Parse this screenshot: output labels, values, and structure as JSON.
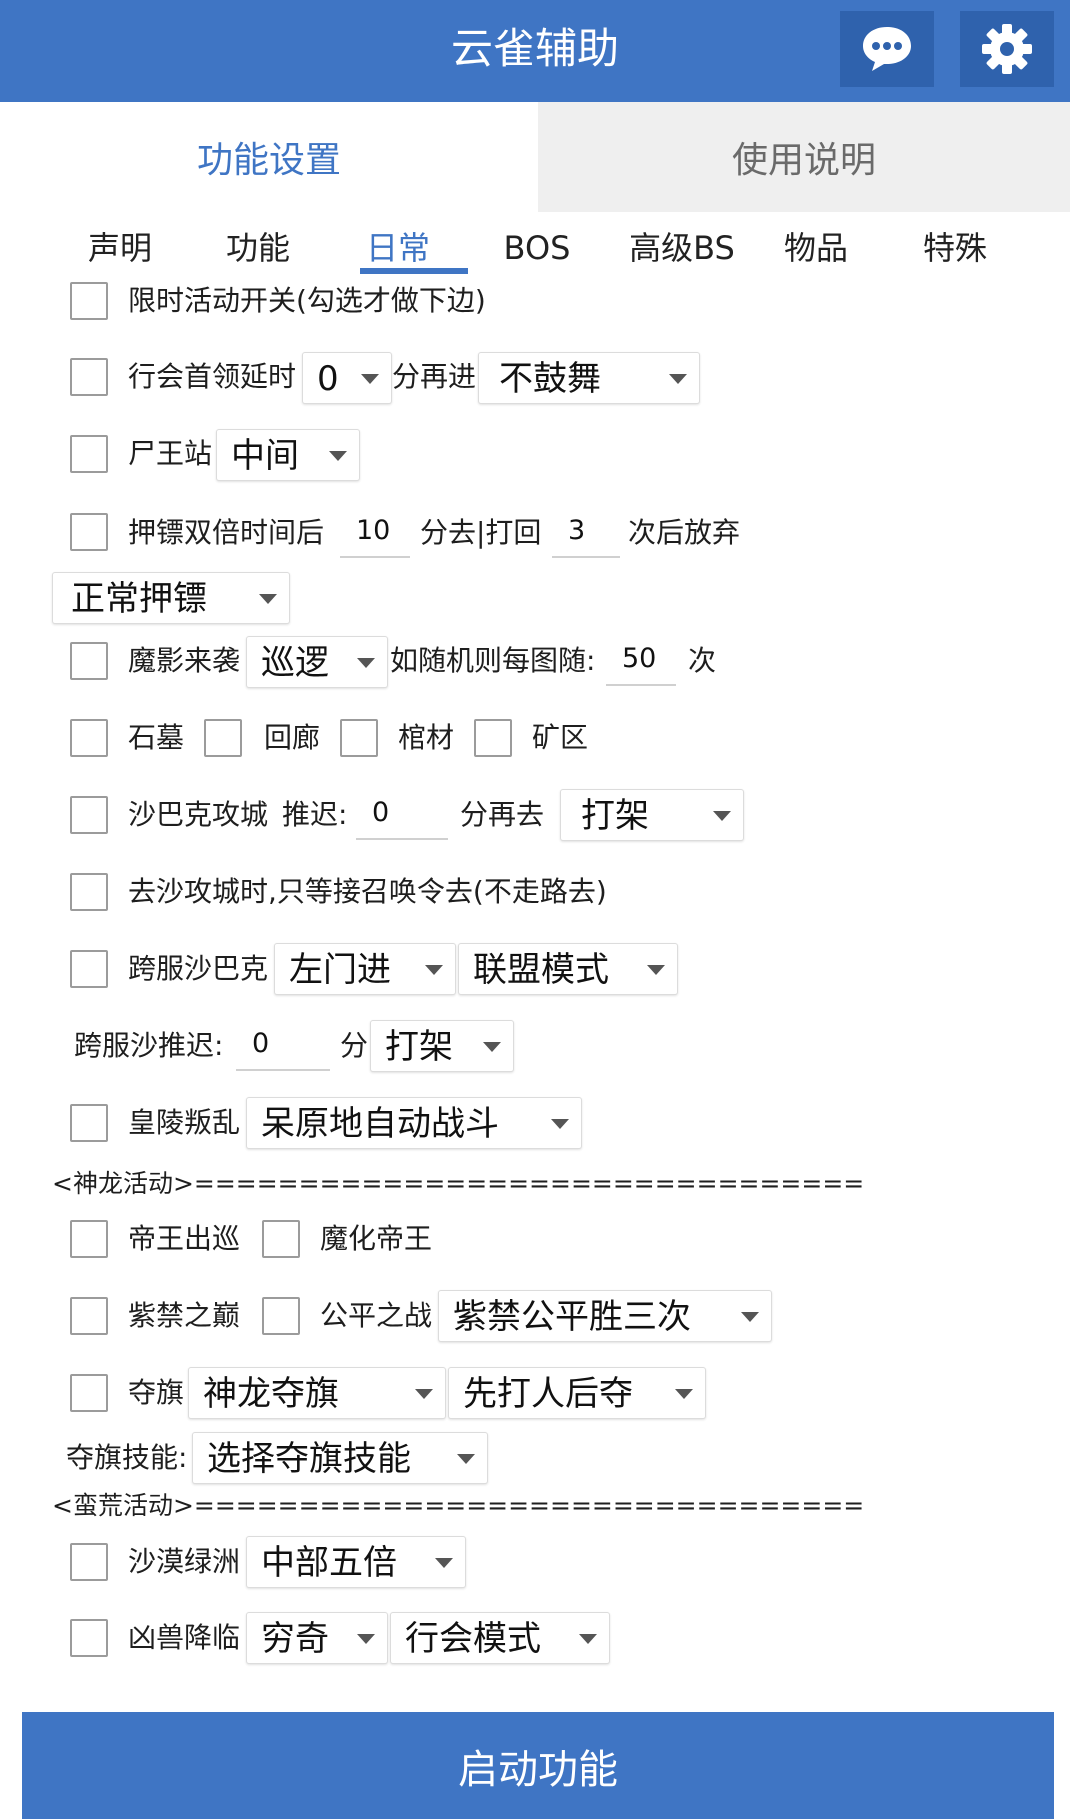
{
  "header": {
    "title": "云雀辅助",
    "chat_icon": "chat-bubble-icon",
    "settings_icon": "gear-icon",
    "color": "#3f75c4"
  },
  "main_tabs": [
    {
      "label": "功能设置",
      "active": true
    },
    {
      "label": "使用说明",
      "active": false
    }
  ],
  "sub_tabs": [
    {
      "label": "声明"
    },
    {
      "label": "功能"
    },
    {
      "label": "日常",
      "active": true
    },
    {
      "label": "BOS"
    },
    {
      "label": "高级BS"
    },
    {
      "label": "物品"
    },
    {
      "label": "特殊"
    }
  ],
  "rows": {
    "limited": {
      "label": "限时活动开关(勾选才做下边)"
    },
    "guild_leader": {
      "label": "行会首领延时",
      "delay": "0",
      "mid": "分再进",
      "mode": "不鼓舞"
    },
    "corpse_king": {
      "label": "尸王站",
      "pos": "中间"
    },
    "escort": {
      "label": "押镖双倍时间后",
      "minutes": "10",
      "mid": "分去|打回",
      "times": "3",
      "tail": "次后放弃",
      "mode": "正常押镖"
    },
    "shadow": {
      "label": "魔影来袭",
      "mode": "巡逻",
      "mid": "如随机则每图随:",
      "count": "50",
      "tail": "次"
    },
    "areas": {
      "items": [
        "石墓",
        "回廊",
        "棺材",
        "矿区"
      ]
    },
    "sabac": {
      "label": "沙巴克攻城",
      "delay_label": "推迟:",
      "delay": "0",
      "mid": "分再去",
      "mode": "打架"
    },
    "sabac_summon": {
      "label": "去沙攻城时,只等接召唤令去(不走路去)"
    },
    "cross_sabac": {
      "label": "跨服沙巴克",
      "gate": "左门进",
      "mode": "联盟模式"
    },
    "cross_delay": {
      "label": "跨服沙推迟:",
      "delay": "0",
      "unit": "分",
      "mode": "打架"
    },
    "tomb_revolt": {
      "label": "皇陵叛乱",
      "mode": "呆原地自动战斗"
    },
    "dragon_sep": "<神龙活动>================================",
    "emperor": {
      "label": "帝王出巡",
      "label2": "魔化帝王"
    },
    "forbidden": {
      "label": "紫禁之巅",
      "label2": "公平之战",
      "mode": "紫禁公平胜三次"
    },
    "flag": {
      "label": "夺旗",
      "mode": "神龙夺旗",
      "strategy": "先打人后夺"
    },
    "flag_skill": {
      "label": "夺旗技能:",
      "mode": "选择夺旗技能"
    },
    "wild_sep": "<蛮荒活动>================================",
    "oasis": {
      "label": "沙漠绿洲",
      "mode": "中部五倍"
    },
    "beast": {
      "label": "凶兽降临",
      "boss": "穷奇",
      "mode": "行会模式"
    }
  },
  "start_button": "启动功能"
}
